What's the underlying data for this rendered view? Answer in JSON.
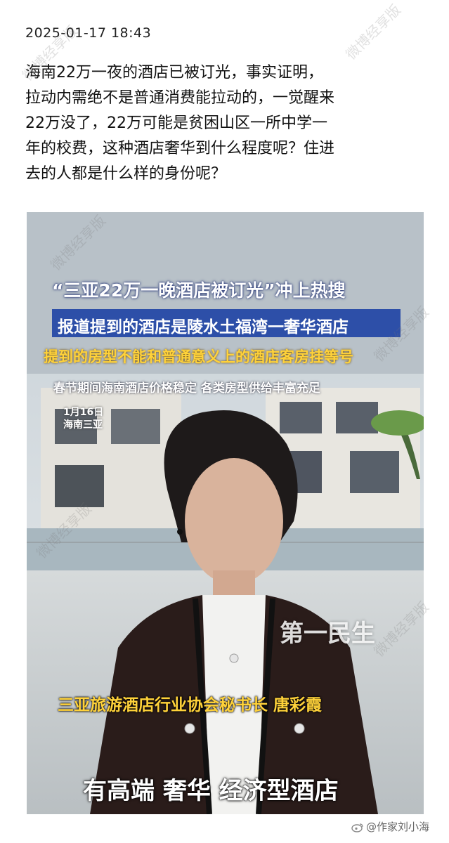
{
  "post": {
    "timestamp": "2025-01-17 18:43",
    "text_lines": [
      "海南22万一夜的酒店已被订光，事实证明，",
      "拉动内需绝不是普通消费能拉动的，一觉醒来",
      "22万没了，22万可能是贫困山区一所中学一",
      "年的校费，这种酒店奢华到什么程度呢？住进",
      "去的人都是什么样的身份呢？"
    ]
  },
  "video": {
    "caption_1": "“三亚22万一晚酒店被订光”冲上热搜",
    "caption_2": "报道提到的酒店是陵水土福湾一奢华酒店",
    "caption_3": "提到的房型不能和普通意义上的酒店客房挂等号",
    "caption_4": "春节期间海南酒店价格稳定 各类房型供给丰富充足",
    "date": "1月16日",
    "location": "海南三亚",
    "channel_logo": "第一民生",
    "speaker": "三亚旅游酒店行业协会秘书长 唐彩霞",
    "subtitle": "有高端 奢华 经济型酒店"
  },
  "watermark": "微博经享版",
  "credit": "@作家刘小海",
  "colors": {
    "caption_blue": "#2d4fa8",
    "caption_yellow": "#ffd23a"
  }
}
